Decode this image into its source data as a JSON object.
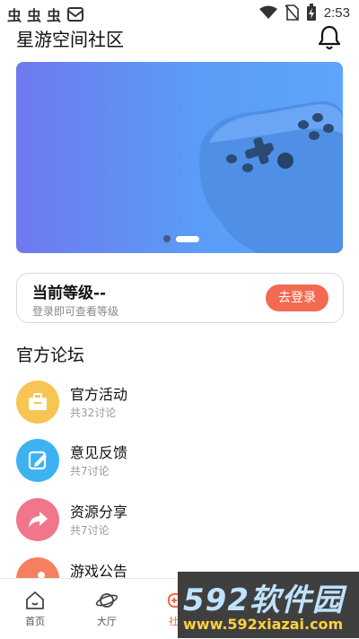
{
  "status_bar": {
    "notif_glyphs": [
      "虫",
      "虫",
      "虫"
    ],
    "time": "2:53",
    "icons": [
      "wifi-icon",
      "no-sim-icon",
      "battery-charging-icon"
    ]
  },
  "header": {
    "title": "星游空间社区",
    "bell_icon": "bell-icon"
  },
  "banner": {
    "image": "game-controller",
    "active_index": 1,
    "count": 2
  },
  "level_card": {
    "title": "当前等级--",
    "subtitle": "登录即可查看等级",
    "login_label": "去登录"
  },
  "forum": {
    "title": "官方论坛",
    "items": [
      {
        "name": "官方活动",
        "count": "共32讨论",
        "icon": "briefcase-icon",
        "color": "#f7c553"
      },
      {
        "name": "意见反馈",
        "count": "共7讨论",
        "icon": "edit-icon",
        "color": "#3db2f0"
      },
      {
        "name": "资源分享",
        "count": "共7讨论",
        "icon": "share-icon",
        "color": "#f2768a"
      },
      {
        "name": "游戏公告",
        "count": "",
        "icon": "shapes-icon",
        "color": "#f4805e"
      }
    ]
  },
  "bottom_nav": {
    "items": [
      {
        "label": "首页",
        "icon": "home-icon"
      },
      {
        "label": "大厅",
        "icon": "planet-icon"
      },
      {
        "label": "社区",
        "icon": "gamepad-icon",
        "active": true
      },
      {
        "label": "",
        "icon": "compass-icon"
      },
      {
        "label": "",
        "icon": "profile-icon"
      }
    ]
  },
  "watermark": {
    "logo": "592软件园",
    "url": "www.592xiazai.com"
  },
  "colors": {
    "accent": "#f26a4f",
    "banner_start": "#6f79ee",
    "banner_end": "#5da5fa"
  }
}
